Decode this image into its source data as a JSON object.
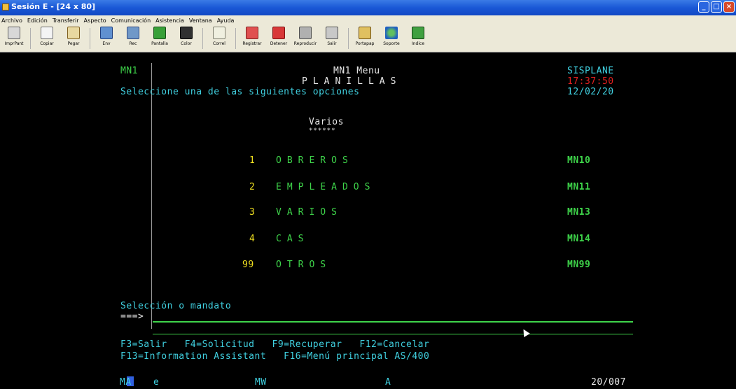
{
  "window": {
    "title": "Sesión E - [24 x 80]",
    "buttons": [
      "_",
      "□",
      "×"
    ]
  },
  "menu": [
    "Archivo",
    "Edición",
    "Transferir",
    "Aspecto",
    "Comunicación",
    "Asistencia",
    "Ventana",
    "Ayuda"
  ],
  "toolbar": [
    {
      "label": "ImprPant",
      "icon": "printer-icon"
    },
    {
      "label": "Copiar",
      "icon": "copy-icon"
    },
    {
      "label": "Pegar",
      "icon": "paste-icon"
    },
    {
      "label": "Env",
      "icon": "send-icon"
    },
    {
      "label": "Rec",
      "icon": "receive-icon"
    },
    {
      "label": "Pantalla",
      "icon": "screen-icon"
    },
    {
      "label": "Color",
      "icon": "color-icon"
    },
    {
      "label": "Correl",
      "icon": "mail-icon"
    },
    {
      "label": "Registrar",
      "icon": "record-icon"
    },
    {
      "label": "Detener",
      "icon": "stop-icon"
    },
    {
      "label": "Reproducir",
      "icon": "play-icon"
    },
    {
      "label": "Salir",
      "icon": "exit-icon"
    },
    {
      "label": "Portapap",
      "icon": "clipboard-icon"
    },
    {
      "label": "Soporte",
      "icon": "globe-icon"
    },
    {
      "label": "Indice",
      "icon": "help-icon"
    }
  ],
  "screen": {
    "menu_id": "MN1",
    "menu_title": "MN1 Menu",
    "heading": "PLANILLAS",
    "system": "SISPLANE",
    "time": "17:37:50",
    "date": "12/02/20",
    "instruction": "Seleccione una de las siguientes opciones",
    "section_title": "Varios",
    "section_underline": "******",
    "options": [
      {
        "number": "1",
        "label": "OBREROS",
        "code": "MN10"
      },
      {
        "number": "2",
        "label": "EMPLEADOS",
        "code": "MN11"
      },
      {
        "number": "3",
        "label": "VARIOS",
        "code": "MN13"
      },
      {
        "number": "4",
        "label": "CAS",
        "code": "MN14"
      },
      {
        "number": "99",
        "label": "OTROS",
        "code": "MN99"
      }
    ],
    "prompt_label": "Selección o mandato",
    "prompt_arrow": "===>",
    "fkeys_line1": "F3=Salir   F4=Solicitud   F9=Recuperar   F12=Cancelar",
    "fkeys_line2": "F13=Information Assistant   F16=Menú principal AS/400"
  },
  "statusbar": {
    "mode": "MA",
    "session": "e",
    "mw": "MW",
    "a": "A",
    "position": "20/007"
  }
}
